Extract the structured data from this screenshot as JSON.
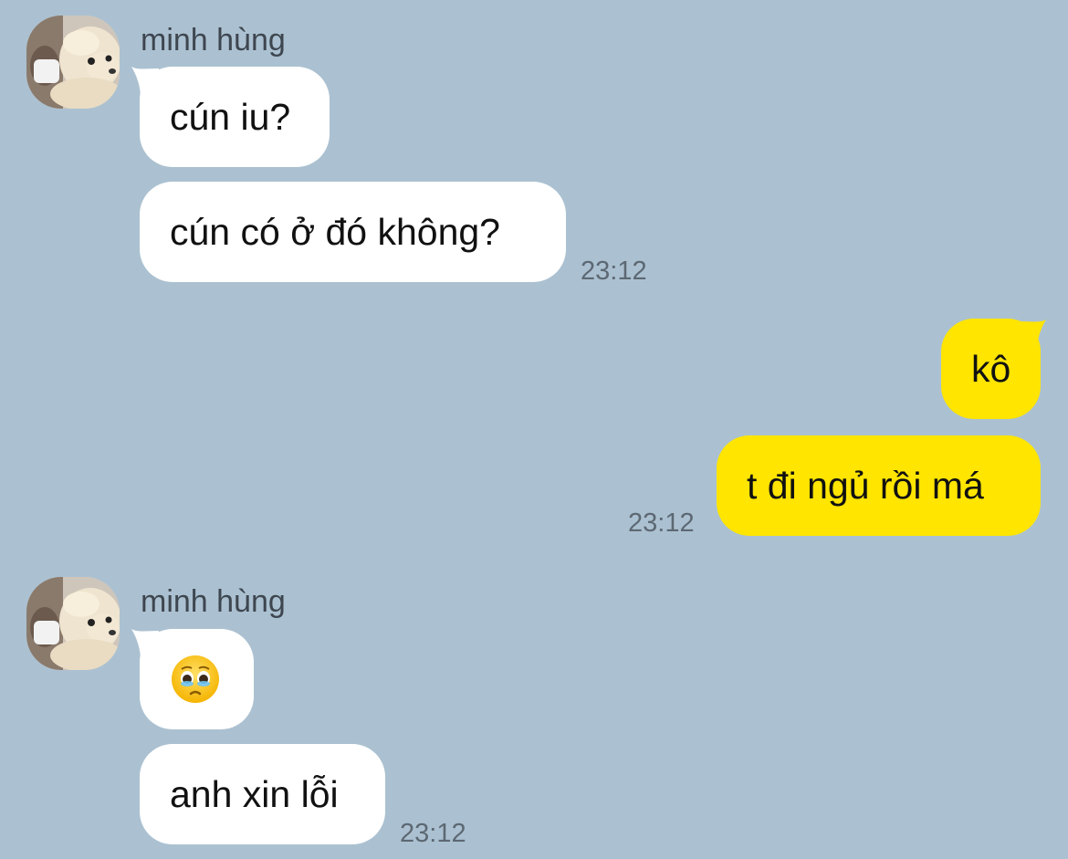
{
  "conversation": {
    "groups": [
      {
        "sender": "minh hùng",
        "avatar_icon": "dog-avatar-icon",
        "messages": [
          "cún iu?",
          "cún có ở đó không?"
        ],
        "time": "23:12"
      },
      {
        "sender": "me",
        "messages": [
          "kô",
          "t đi ngủ rồi má"
        ],
        "time": "23:12"
      },
      {
        "sender": "minh hùng",
        "avatar_icon": "dog-avatar-icon",
        "messages": [
          "🥹",
          "anh xin lỗi"
        ],
        "emoji_name": "face-holding-back-tears",
        "time": "23:12"
      }
    ]
  },
  "colors": {
    "background": "#abc1d1",
    "incoming_bubble": "#ffffff",
    "outgoing_bubble": "#ffe500",
    "timestamp": "#5d6873",
    "sender_name": "#3e4650"
  }
}
